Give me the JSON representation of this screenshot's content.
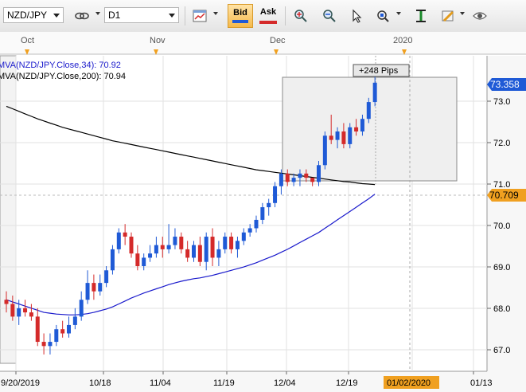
{
  "toolbar": {
    "symbol": "NZD/JPY",
    "timeframe": "D1",
    "bid_label": "Bid",
    "ask_label": "Ask"
  },
  "chart": {
    "month_labels": [
      "Oct",
      "Nov",
      "Dec",
      "2020"
    ],
    "date_labels": [
      "9/20/2019",
      "10/18",
      "11/04",
      "11/19",
      "12/04",
      "12/19",
      "01/02/2020",
      "01/13"
    ],
    "price_labels": [
      "73.0",
      "72.0",
      "71.0",
      "70.0",
      "69.0",
      "68.0",
      "67.0"
    ],
    "indicators": [
      {
        "label": "MVA(NZD/JPY.Close,34): 70.92",
        "color": "#1a1acc"
      },
      {
        "label": "MVA(NZD/JPY.Close,200): 70.94",
        "color": "#000000"
      }
    ],
    "current_price": "73.358",
    "mva_price": "70.709",
    "pips_label": "+248 Pips",
    "colors": {
      "up": "#1f5ad6",
      "down": "#d42a2a",
      "price_tag": "#1f5ad6",
      "mva_tag": "#f0a020",
      "date_tag": "#f0a020"
    }
  },
  "chart_data": {
    "type": "candlestick",
    "ylim": [
      66.5,
      74.0
    ],
    "candles": [
      [
        68.2,
        68.4,
        67.9,
        68.1
      ],
      [
        68.1,
        68.3,
        67.7,
        67.8
      ],
      [
        67.8,
        68.2,
        67.6,
        68.0
      ],
      [
        68.0,
        68.2,
        67.8,
        67.9
      ],
      [
        67.9,
        68.1,
        67.7,
        67.8
      ],
      [
        67.8,
        68.0,
        67.1,
        67.2
      ],
      [
        67.2,
        67.4,
        66.9,
        67.1
      ],
      [
        67.1,
        67.4,
        66.9,
        67.2
      ],
      [
        67.2,
        67.6,
        67.1,
        67.5
      ],
      [
        67.5,
        67.7,
        67.3,
        67.4
      ],
      [
        67.4,
        67.8,
        67.3,
        67.6
      ],
      [
        67.6,
        68.0,
        67.5,
        67.8
      ],
      [
        67.8,
        68.4,
        67.7,
        68.2
      ],
      [
        68.2,
        68.9,
        68.1,
        68.6
      ],
      [
        68.6,
        68.8,
        68.2,
        68.4
      ],
      [
        68.4,
        68.8,
        68.3,
        68.6
      ],
      [
        68.6,
        69.0,
        68.5,
        68.9
      ],
      [
        68.9,
        69.5,
        68.8,
        69.4
      ],
      [
        69.4,
        69.9,
        69.3,
        69.8
      ],
      [
        69.8,
        70.0,
        69.5,
        69.7
      ],
      [
        69.7,
        69.8,
        69.2,
        69.3
      ],
      [
        69.3,
        69.5,
        68.9,
        69.0
      ],
      [
        69.0,
        69.3,
        68.9,
        69.2
      ],
      [
        69.2,
        69.5,
        69.1,
        69.3
      ],
      [
        69.3,
        69.7,
        69.2,
        69.5
      ],
      [
        69.5,
        69.7,
        69.2,
        69.4
      ],
      [
        69.4,
        70.0,
        69.3,
        69.5
      ],
      [
        69.5,
        69.9,
        69.4,
        69.7
      ],
      [
        69.7,
        69.8,
        69.3,
        69.4
      ],
      [
        69.4,
        69.6,
        69.1,
        69.2
      ],
      [
        69.2,
        69.6,
        69.1,
        69.5
      ],
      [
        69.5,
        69.7,
        69.0,
        69.1
      ],
      [
        69.1,
        69.8,
        68.9,
        69.7
      ],
      [
        69.7,
        69.9,
        69.0,
        69.2
      ],
      [
        69.2,
        69.6,
        69.0,
        69.4
      ],
      [
        69.4,
        69.8,
        69.3,
        69.7
      ],
      [
        69.7,
        69.8,
        69.3,
        69.4
      ],
      [
        69.4,
        69.7,
        69.2,
        69.6
      ],
      [
        69.6,
        69.9,
        69.5,
        69.8
      ],
      [
        69.8,
        70.0,
        69.7,
        69.9
      ],
      [
        69.9,
        70.2,
        69.8,
        70.1
      ],
      [
        70.1,
        70.5,
        70.0,
        70.4
      ],
      [
        70.4,
        70.6,
        70.2,
        70.5
      ],
      [
        70.5,
        71.0,
        70.4,
        70.9
      ],
      [
        70.9,
        71.3,
        70.7,
        71.2
      ],
      [
        71.2,
        71.3,
        70.9,
        71.0
      ],
      [
        71.0,
        71.2,
        70.9,
        71.1
      ],
      [
        71.1,
        71.3,
        70.9,
        71.2
      ],
      [
        71.2,
        71.3,
        71.0,
        71.1
      ],
      [
        71.1,
        71.1,
        70.9,
        71.0
      ],
      [
        71.0,
        71.5,
        70.9,
        71.4
      ],
      [
        71.4,
        72.2,
        71.3,
        72.1
      ],
      [
        72.1,
        72.6,
        71.9,
        72.0
      ],
      [
        72.0,
        72.3,
        71.8,
        72.2
      ],
      [
        72.2,
        72.4,
        71.8,
        71.9
      ],
      [
        71.9,
        72.4,
        71.8,
        72.3
      ],
      [
        72.3,
        72.5,
        72.1,
        72.2
      ],
      [
        72.2,
        72.6,
        72.1,
        72.5
      ],
      [
        72.5,
        73.0,
        72.4,
        72.9
      ],
      [
        72.9,
        73.5,
        72.8,
        73.36
      ]
    ],
    "series": [
      {
        "name": "MVA(NZD/JPY.Close,34)",
        "values": [
          68.2,
          68.15,
          68.1,
          68.05,
          68.0,
          67.95,
          67.9,
          67.88,
          67.86,
          67.85,
          67.84,
          67.84,
          67.85,
          67.87,
          67.9,
          67.94,
          67.98,
          68.03,
          68.1,
          68.17,
          68.24,
          68.3,
          68.36,
          68.41,
          68.46,
          68.51,
          68.56,
          68.6,
          68.64,
          68.67,
          68.7,
          68.72,
          68.75,
          68.78,
          68.82,
          68.86,
          68.9,
          68.94,
          68.98,
          69.03,
          69.08,
          69.14,
          69.2,
          69.26,
          69.33,
          69.4,
          69.48,
          69.56,
          69.64,
          69.72,
          69.8,
          69.9,
          70.0,
          70.1,
          70.2,
          70.3,
          70.4,
          70.5,
          70.6,
          70.71
        ]
      },
      {
        "name": "MVA(NZD/JPY.Close,200)",
        "values": [
          72.8,
          72.74,
          72.68,
          72.62,
          72.56,
          72.5,
          72.45,
          72.4,
          72.35,
          72.3,
          72.26,
          72.22,
          72.18,
          72.14,
          72.1,
          72.06,
          72.02,
          71.98,
          71.95,
          71.92,
          71.89,
          71.86,
          71.83,
          71.8,
          71.77,
          71.74,
          71.71,
          71.68,
          71.65,
          71.62,
          71.59,
          71.56,
          71.53,
          71.5,
          71.47,
          71.44,
          71.41,
          71.38,
          71.35,
          71.32,
          71.29,
          71.27,
          71.25,
          71.23,
          71.21,
          71.19,
          71.17,
          71.15,
          71.13,
          71.11,
          71.09,
          71.07,
          71.05,
          71.03,
          71.01,
          71.0,
          70.98,
          70.96,
          70.95,
          70.94
        ]
      }
    ]
  }
}
